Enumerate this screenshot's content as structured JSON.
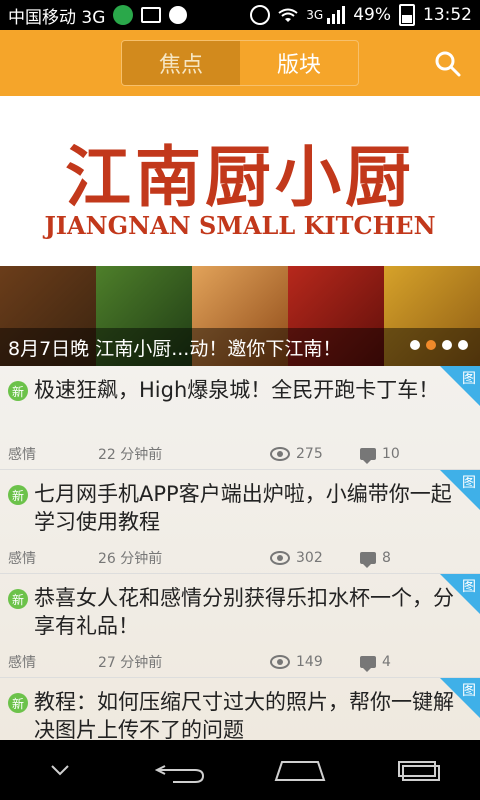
{
  "status_bar": {
    "carrier": "中国移动 3G",
    "battery": "49%",
    "time": "13:52",
    "signal_label": "3G"
  },
  "header": {
    "tabs": [
      {
        "label": "焦点",
        "active": true
      },
      {
        "label": "版块",
        "active": false
      }
    ],
    "search_icon": "search-icon",
    "accent": "#f5a52a"
  },
  "banner": {
    "brand_cn": "江南厨小厨",
    "brand_en": "JIANGNAN SMALL KITCHEN",
    "caption": "8月7日晚 江南小厨...动！邀你下江南！",
    "dots": 4,
    "active_dot_index": 1
  },
  "list": {
    "items": [
      {
        "new_badge": "新",
        "title": "极速狂飙，High爆泉城！全民开跑卡丁车！",
        "corner_label": "图",
        "category": "感情",
        "time": "22 分钟前",
        "views": "275",
        "comments": "10"
      },
      {
        "new_badge": "新",
        "title": "七月网手机APP客户端出炉啦，小编带你一起学习使用教程",
        "corner_label": "图",
        "category": "感情",
        "time": "26 分钟前",
        "views": "302",
        "comments": "8"
      },
      {
        "new_badge": "新",
        "title": "恭喜女人花和感情分别获得乐扣水杯一个，分享有礼品！",
        "corner_label": "图",
        "category": "感情",
        "time": "27 分钟前",
        "views": "149",
        "comments": "4"
      },
      {
        "new_badge": "新",
        "title": "教程：如何压缩尺寸过大的照片，帮你一键解决图片上传不了的问题",
        "corner_label": "图",
        "category": "",
        "time": "",
        "views": "",
        "comments": ""
      }
    ]
  },
  "nav_bar": {
    "icons": [
      "chevron-down-icon",
      "back-icon",
      "home-icon",
      "recent-apps-icon"
    ]
  }
}
